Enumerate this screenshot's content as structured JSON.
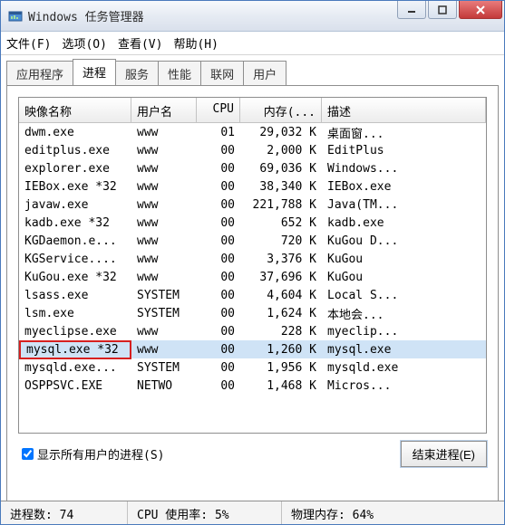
{
  "titlebar": {
    "title": "Windows 任务管理器"
  },
  "menus": {
    "file": "文件(F)",
    "options": "选项(O)",
    "view": "查看(V)",
    "help": "帮助(H)"
  },
  "tabs": {
    "apps": "应用程序",
    "processes": "进程",
    "services": "服务",
    "performance": "性能",
    "networking": "联网",
    "users": "用户"
  },
  "columns": {
    "name": "映像名称",
    "user": "用户名",
    "cpu": "CPU",
    "mem": "内存(...",
    "desc": "描述"
  },
  "rows": [
    {
      "name": "dwm.exe",
      "user": "www",
      "cpu": "01",
      "mem": "29,032 K",
      "desc": "桌面窗...",
      "selected": false,
      "highlighted": false
    },
    {
      "name": "editplus.exe",
      "user": "www",
      "cpu": "00",
      "mem": "2,000 K",
      "desc": "EditPlus",
      "selected": false,
      "highlighted": false
    },
    {
      "name": "explorer.exe",
      "user": "www",
      "cpu": "00",
      "mem": "69,036 K",
      "desc": "Windows...",
      "selected": false,
      "highlighted": false
    },
    {
      "name": "IEBox.exe *32",
      "user": "www",
      "cpu": "00",
      "mem": "38,340 K",
      "desc": "IEBox.exe",
      "selected": false,
      "highlighted": false
    },
    {
      "name": "javaw.exe",
      "user": "www",
      "cpu": "00",
      "mem": "221,788 K",
      "desc": "Java(TM...",
      "selected": false,
      "highlighted": false
    },
    {
      "name": "kadb.exe *32",
      "user": "www",
      "cpu": "00",
      "mem": "652 K",
      "desc": "kadb.exe",
      "selected": false,
      "highlighted": false
    },
    {
      "name": "KGDaemon.e...",
      "user": "www",
      "cpu": "00",
      "mem": "720 K",
      "desc": "KuGou D...",
      "selected": false,
      "highlighted": false
    },
    {
      "name": "KGService....",
      "user": "www",
      "cpu": "00",
      "mem": "3,376 K",
      "desc": "KuGou",
      "selected": false,
      "highlighted": false
    },
    {
      "name": "KuGou.exe *32",
      "user": "www",
      "cpu": "00",
      "mem": "37,696 K",
      "desc": "KuGou",
      "selected": false,
      "highlighted": false
    },
    {
      "name": "lsass.exe",
      "user": "SYSTEM",
      "cpu": "00",
      "mem": "4,604 K",
      "desc": "Local S...",
      "selected": false,
      "highlighted": false
    },
    {
      "name": "lsm.exe",
      "user": "SYSTEM",
      "cpu": "00",
      "mem": "1,624 K",
      "desc": "本地会...",
      "selected": false,
      "highlighted": false
    },
    {
      "name": "myeclipse.exe",
      "user": "www",
      "cpu": "00",
      "mem": "228 K",
      "desc": "myeclip...",
      "selected": false,
      "highlighted": false
    },
    {
      "name": "mysql.exe *32",
      "user": "www",
      "cpu": "00",
      "mem": "1,260 K",
      "desc": "mysql.exe",
      "selected": true,
      "highlighted": true
    },
    {
      "name": "mysqld.exe...",
      "user": "SYSTEM",
      "cpu": "00",
      "mem": "1,956 K",
      "desc": "mysqld.exe",
      "selected": false,
      "highlighted": false
    },
    {
      "name": "OSPPSVC.EXE",
      "user": "NETWO",
      "cpu": "00",
      "mem": "1,468 K",
      "desc": "Micros...",
      "selected": false,
      "highlighted": false
    }
  ],
  "checkbox": {
    "label": "显示所有用户的进程(S)",
    "checked": true
  },
  "buttons": {
    "end_process": "结束进程(E)"
  },
  "status": {
    "processes": "进程数: 74",
    "cpu": "CPU 使用率: 5%",
    "mem": "物理内存: 64%"
  }
}
